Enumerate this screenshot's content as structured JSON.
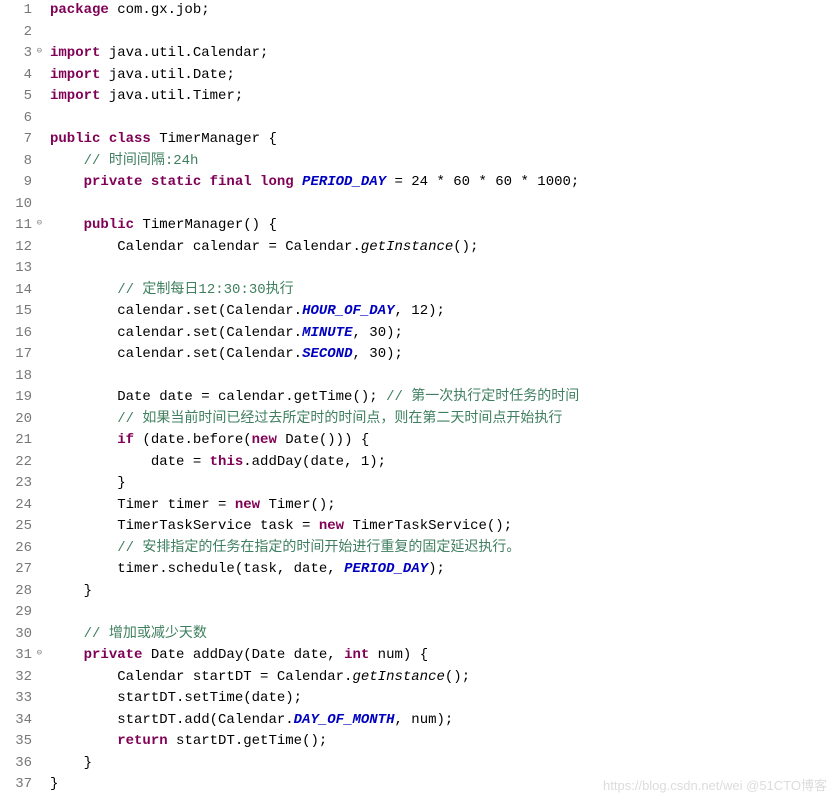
{
  "gutter": [
    "1",
    "2",
    "3",
    "4",
    "5",
    "6",
    "7",
    "8",
    "9",
    "10",
    "11",
    "12",
    "13",
    "14",
    "15",
    "16",
    "17",
    "18",
    "19",
    "20",
    "21",
    "22",
    "23",
    "24",
    "25",
    "26",
    "27",
    "28",
    "29",
    "30",
    "31",
    "32",
    "33",
    "34",
    "35",
    "36",
    "37"
  ],
  "fold_markers": {
    "3": "⊖",
    "11": "⊖",
    "31": "⊖"
  },
  "code": {
    "l1": {
      "kw1": "package",
      "rest": " com.gx.job;"
    },
    "l3": {
      "kw1": "import",
      "rest": " java.util.Calendar;"
    },
    "l4": {
      "kw1": "import",
      "rest": " java.util.Date;"
    },
    "l5": {
      "kw1": "import",
      "rest": " java.util.Timer;"
    },
    "l7": {
      "kw1": "public",
      "kw2": "class",
      "name": " TimerManager {"
    },
    "l8": {
      "comment": "// 时间间隔:24h"
    },
    "l9": {
      "kw": "private static final long ",
      "const": "PERIOD_DAY",
      "rest": " = 24 * 60 * 60 * 1000;"
    },
    "l11": {
      "kw1": "public",
      "rest": " TimerManager() {"
    },
    "l12": {
      "a": "Calendar calendar = Calendar.",
      "m": "getInstance",
      "b": "();"
    },
    "l14": {
      "comment": "// 定制每日12:30:30执行"
    },
    "l15": {
      "a": "calendar.set(Calendar.",
      "c": "HOUR_OF_DAY",
      "b": ", 12);"
    },
    "l16": {
      "a": "calendar.set(Calendar.",
      "c": "MINUTE",
      "b": ", 30);"
    },
    "l17": {
      "a": "calendar.set(Calendar.",
      "c": "SECOND",
      "b": ", 30);"
    },
    "l19": {
      "a": "Date date = calendar.getTime(); ",
      "comment": "// 第一次执行定时任务的时间"
    },
    "l20": {
      "comment": "// 如果当前时间已经过去所定时的时间点，则在第二天时间点开始执行"
    },
    "l21": {
      "kw1": "if",
      "a": " (date.before(",
      "kw2": "new",
      "b": " Date())) {"
    },
    "l22": {
      "a": "date = ",
      "kw1": "this",
      "b": ".addDay(date, 1);"
    },
    "l23": {
      "a": "}"
    },
    "l24": {
      "a": "Timer timer = ",
      "kw1": "new",
      "b": " Timer();"
    },
    "l25": {
      "a": "TimerTaskService task = ",
      "kw1": "new",
      "b": " TimerTaskService();"
    },
    "l26": {
      "comment": "// 安排指定的任务在指定的时间开始进行重复的固定延迟执行。"
    },
    "l27": {
      "a": "timer.schedule(task, date, ",
      "c": "PERIOD_DAY",
      "b": ");"
    },
    "l28": {
      "a": "}"
    },
    "l30": {
      "comment": "// 增加或减少天数"
    },
    "l31": {
      "kw1": "private",
      "a": " Date addDay(Date date, ",
      "kw2": "int",
      "b": " num) {"
    },
    "l32": {
      "a": "Calendar startDT = Calendar.",
      "m": "getInstance",
      "b": "();"
    },
    "l33": {
      "a": "startDT.setTime(date);"
    },
    "l34": {
      "a": "startDT.add(Calendar.",
      "c": "DAY_OF_MONTH",
      "b": ", num);"
    },
    "l35": {
      "kw1": "return",
      "a": " startDT.getTime();"
    },
    "l36": {
      "a": "}"
    },
    "l37": {
      "a": "}"
    }
  },
  "watermark": "https://blog.csdn.net/wei @51CTO博客"
}
